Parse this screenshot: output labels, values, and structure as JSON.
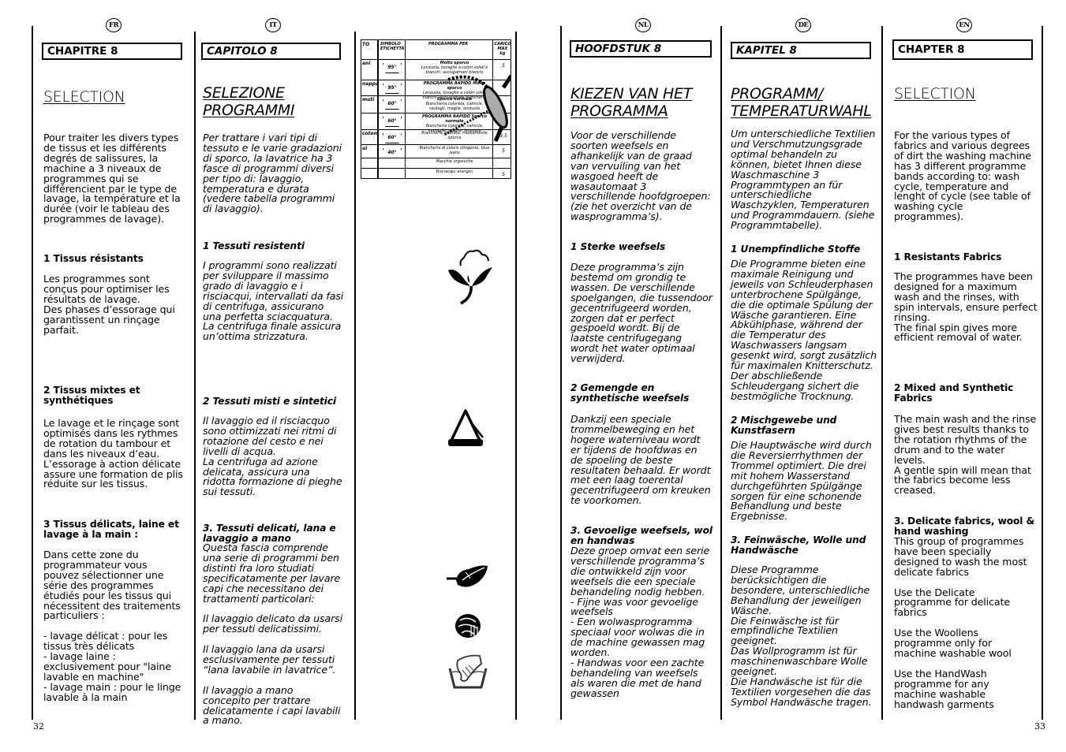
{
  "pages": {
    "left_number": "32",
    "right_number": "33"
  },
  "columns": {
    "fr": {
      "lang_badge": "FR",
      "chapter": "CHAPITRE 8",
      "title": "SELECTION",
      "intro": "Pour traiter les divers types\nde tissus et les différents\ndegrés de salissures, la\nmachine a 3 niveaux de\nprogrammes qui se\ndifférencient par le type de\nlavage, la température et la\ndurée (voir le tableau des\nprogrammes de lavage).",
      "s1_head": "1 Tissus résistants",
      "s1_body": "Les programmes sont\nconçus pour optimiser les\nrésultats de lavage.\nDes phases d’essorage qui\ngarantissent un rinçage\nparfait.",
      "s2_head": "2 Tissus mixtes et\nsynthétiques",
      "s2_body": "Le lavage et le rinçage sont\noptimisés dans les rythmes\nde rotation du tambour et\ndans les niveaux d’eau.\nL’essorage à action délicate\nassure une formation de plis\nréduite sur les tissus.",
      "s3_head": "3 Tissus délicats, laine et\nlavage à la main :",
      "s3_body": "Dans cette zone du\nprogrammateur vous\npouvez sélectionner une\nsérie des programmes\nétudiés pour les tissus qui\nnécessitent des traitements\nparticuliers :\n\n- lavage délicat : pour les\ntissus très délicats\n- lavage laine :\nexclusivement pour \"laine\nlavable en machine\"\n- lavage main : pour le linge\nlavable à la main"
    },
    "it": {
      "lang_badge": "IT",
      "chapter": "CAPITOLO 8",
      "title": "SELEZIONE\nPROGRAMMI",
      "intro": "Per trattare i vari tipi di\ntessuto e le varie gradazioni\ndi sporco, la lavatrice ha 3\nfasce di programmi diversi\nper tipo di: lavaggio,\ntemperatura e durata\n(vedere tabella programmi\ndi lavaggio).",
      "s1_head": "1 Tessuti resistenti",
      "s1_body": "I programmi sono realizzati\nper sviluppare il massimo\ngrado di lavaggio e i\nrisciacqui, intervallati da fasi\ndi centrifuga, assicurano\nuna perfetta sciacquatura.\nLa centrifuga finale assicura\nun’ottima strizzatura.",
      "s2_head": "2 Tessuti misti e sintetici",
      "s2_body": "Il lavaggio ed il risciacquo\nsono ottimizzati nei ritmi di\nrotazione del cesto e nei\nlivelli di acqua.\nLa centrifuga ad azione\ndelicata, assicura una\nridotta formazione di pieghe\nsui tessuti.",
      "s3_head": "3. Tessuti delicati, lana e\nlavaggio a mano",
      "s3_body": "Questa fascia comprende\nuna serie di programmi ben\ndistinti fra loro studiati\nspecificatamente per lavare\ncapi che necessitano dei\ntrattamenti particolari:\n\nIl lavaggio delicato da usarsi\nper tessuti delicatissimi.\n\nIl lavaggio lana da usarsi\nesclusivamente per tessuti\n“lana lavabile in lavatrice”.\n\nIl lavaggio a mano\nconcepito per trattare\ndelicatamente i capi lavabili\na mano."
    },
    "nl": {
      "lang_badge": "NL",
      "chapter": "HOOFDSTUK 8",
      "title": "KIEZEN VAN HET\nPROGRAMMA",
      "intro": "Voor de verschillende\nsoorten weefsels en\nafhankelijk van de graad\nvan vervuiling van het\nwasgoed heeft de\nwasautomaat 3\nverschillende hoofdgroepen:\n(zie het overzicht van de\nwasprogramma’s).",
      "s1_head": "1 Sterke weefsels",
      "s1_body": "Deze programma’s zijn\nbestemd om grondig te\nwassen. De verschillende\nspoelgangen, die tussendoor\ngecentrifugeerd worden,\nzorgen dat er perfect\ngespoeld wordt. Bij de\nlaatste centrifugegang\nwordt het water optimaal\nverwijderd.",
      "s2_head": "2 Gemengde en\nsynthetische weefsels",
      "s2_body": "Dankzij een speciale\ntrommelbeweging en het\nhogere waterniveau wordt\ner tijdens de hoofdwas en\nde spoeling de beste\nresultaten behaald. Er wordt\nmet een laag toerental\ngecentrifugeerd om kreuken\nte voorkomen.",
      "s3_head": "3. Gevoelige weefsels, wol\nen handwas",
      "s3_body": "Deze groep omvat een serie\nverschillende programma’s\ndie ontwikkeld zijn voor\nweefsels die een speciale\nbehandeling nodig hebben.\n- Fijne was voor gevoelige\nweefsels\n- Een wolwasprogramma\nspeciaal voor wolwas die in\nde machine gewassen mag\nworden.\n- Handwas voor een zachte\nbehandeling van weefsels\nals waren die met de hand\ngewassen"
    },
    "de": {
      "lang_badge": "DE",
      "chapter": "KAPITEL 8",
      "title": "PROGRAMM/\nTEMPERATURWAHL",
      "intro": "Um unterschiedliche Textilien\nund Verschmutzungsgrade\noptimal behandeln zu\nkönnen, bietet Ihnen diese\nWaschmaschine 3\nProgrammtypen an für\nunterschiedliche\nWaschzyklen, Temperaturen\nund Programmdauern. (siehe\nProgrammtabelle).",
      "s1_head": "1 Unempfindliche Stoffe",
      "s1_body": "Die Programme bieten eine\nmaximale Reinigung und\njeweils von Schleuderphasen\nunterbrochene Spülgänge,\ndie die optimale Spülung der\nWäsche garantieren. Eine\nAbkühlphase, während der\ndie Temperatur des\nWaschwassers langsam\ngesenkt wird, sorgt zusätzlich\nfür maximalen Knitterschutz.\nDer abschließende\nSchleudergang sichert die\nbestmögliche Trocknung.",
      "s2_head": "2 Mischgewebe und\nKunstfasern",
      "s2_body": "Die Hauptwäsche wird durch\ndie Reversierrhythmen der\nTrommel optimiert. Die drei\nmit hohem Wasserstand\ndurchgeführten Spülgänge\nsorgen für eine schonende\nBehandlung und beste\nErgebnisse.",
      "s3_head": "3. Feinwäsche, Wolle und\nHandwäsche",
      "s3_body": "Diese Programme\nberücksichtigen die\nbesondere, unterschiedliche\nBehandlung der jeweiligen\nWäsche.\nDie Feinwäsche ist für\nempfindliche Textilien\ngeeignet.\nDas Wollprogramm ist für\nmaschinenwaschbare Wolle\ngeeignet.\nDie Handwäsche ist für die\nTextilien vorgesehen die das\nSymbol Handwäsche tragen."
    },
    "en": {
      "lang_badge": "EN",
      "chapter": "CHAPTER 8",
      "title": "SELECTION",
      "intro": "For the various types of\nfabrics and various degrees\nof dirt the washing machine\nhas 3 different programme\nbands according to: wash\ncycle, temperature and\nlenght of cycle (see table of\nwashing cycle\nprogrammes).",
      "s1_head": "1 Resistants Fabrics",
      "s1_body": "The programmes have been\ndesigned for a maximum\nwash and the rinses, with\nspin intervals, ensure perfect\nrinsing.\nThe final spin gives more\nefficient removal of water.",
      "s2_head": "2 Mixed and Synthetic\nFabrics",
      "s2_body": "The main wash and the rinse\ngives best results thanks to\nthe rotation rhythms of the\ndrum and to the water\nlevels.\nA gentle spin will mean that\nthe fabrics become less\ncreased.",
      "s3_head": "3. Delicate fabrics, wool &\nhand washing",
      "s3_body": "This group of programmes\nhave been specially\ndesigned to wash the most\ndelicate fabrics\n\nUse the Delicate\nprogramme for delicate\nfabrics\n\nUse the Woollens\nprogramme only for\nmachine washable wool\n\nUse the HandWash\nprogramme for any\nmachine washable\nhandwash garments"
    }
  },
  "program_table": {
    "headers": [
      "TO",
      "SIMBOLO\nETICHETTA",
      "PROGRAMMA PER",
      "CARICO\nMAX\nkg"
    ],
    "rows": [
      {
        "type": "ani",
        "symbol": "95°",
        "desc_bold": "Molto sporco",
        "desc": "Lenzuola, tovaglie a colori solidi e bianchi, asciugamani bianchi",
        "load": "5"
      },
      {
        "type": "nappa",
        "symbol": "95°",
        "desc_bold": "PROGRAMMA RAPIDO Molto sporco",
        "desc": "Lenzuola, tovaglie a colori solidi bianchi, asciugamani biancheria",
        "load": ""
      },
      {
        "type": "muti",
        "symbol": "60°",
        "desc_bold": "Sporco normale",
        "desc": "Biancheria colorata, camicie, vestagli, maglie, lenzuola",
        "load": ""
      },
      {
        "type": "",
        "symbol": "60°",
        "desc_bold": "PROGRAMMA RAPIDO Sporco normale",
        "desc": "Biancheria colorata, camicie, vestaglie, maglie, lenzuola",
        "load": ""
      },
      {
        "type": "cotoni",
        "symbol": "60°",
        "desc_bold": "",
        "desc": "Biancheria colorata, mediamente sporca",
        "load": "3.5"
      },
      {
        "type": "ui",
        "symbol": "40°",
        "desc_bold": "",
        "desc": "Biancheria di colore stingente, blue jeans",
        "load": "5"
      },
      {
        "type": "",
        "symbol": "",
        "desc_bold": "",
        "desc": "Macchie organiche",
        "load": ""
      },
      {
        "type": "",
        "symbol": "",
        "desc_bold": "",
        "desc": "Risciacqui energici",
        "load": "5"
      }
    ]
  },
  "symbols": [
    "cotton-flower",
    "synthetic-triangle",
    "delicate-feather",
    "wool-ball",
    "hand-wash-basin"
  ]
}
